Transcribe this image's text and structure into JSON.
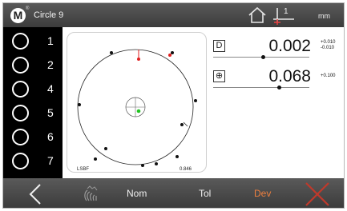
{
  "header": {
    "logo_letter": "M",
    "logo_mark": "®",
    "title": "Circle 9",
    "home_icon": "home-icon",
    "reference_icon": "datum-reference-icon",
    "reference_number": "1",
    "unit": "mm"
  },
  "rail": {
    "items": [
      {
        "label": "1"
      },
      {
        "label": "2"
      },
      {
        "label": "4"
      },
      {
        "label": "5"
      },
      {
        "label": "6"
      },
      {
        "label": "7"
      }
    ]
  },
  "plot": {
    "method": "LSBF",
    "value": "0.846",
    "point_color": "#111111",
    "high_point_color": "#e02020",
    "center_point_color": "#22c422"
  },
  "measurements": [
    {
      "symbol": "D",
      "icon": "diameter-box-icon",
      "value": "0.002",
      "upper_tol": "+0.010",
      "lower_tol": "-0.010",
      "position_fraction": 0.52
    },
    {
      "symbol": "⊕",
      "icon": "position-box-icon",
      "value": "0.068",
      "upper_tol": "+0.100",
      "lower_tol": "",
      "position_fraction": 0.69
    }
  ],
  "footer": {
    "back_icon": "chevron-left-icon",
    "scan_icon": "hand-scan-icon",
    "tabs": [
      "Nom",
      "Tol",
      "Dev"
    ],
    "active_tab": "Dev",
    "active_color": "#ec7f3f",
    "close_icon": "close-x-icon",
    "close_color": "#c0392b"
  }
}
